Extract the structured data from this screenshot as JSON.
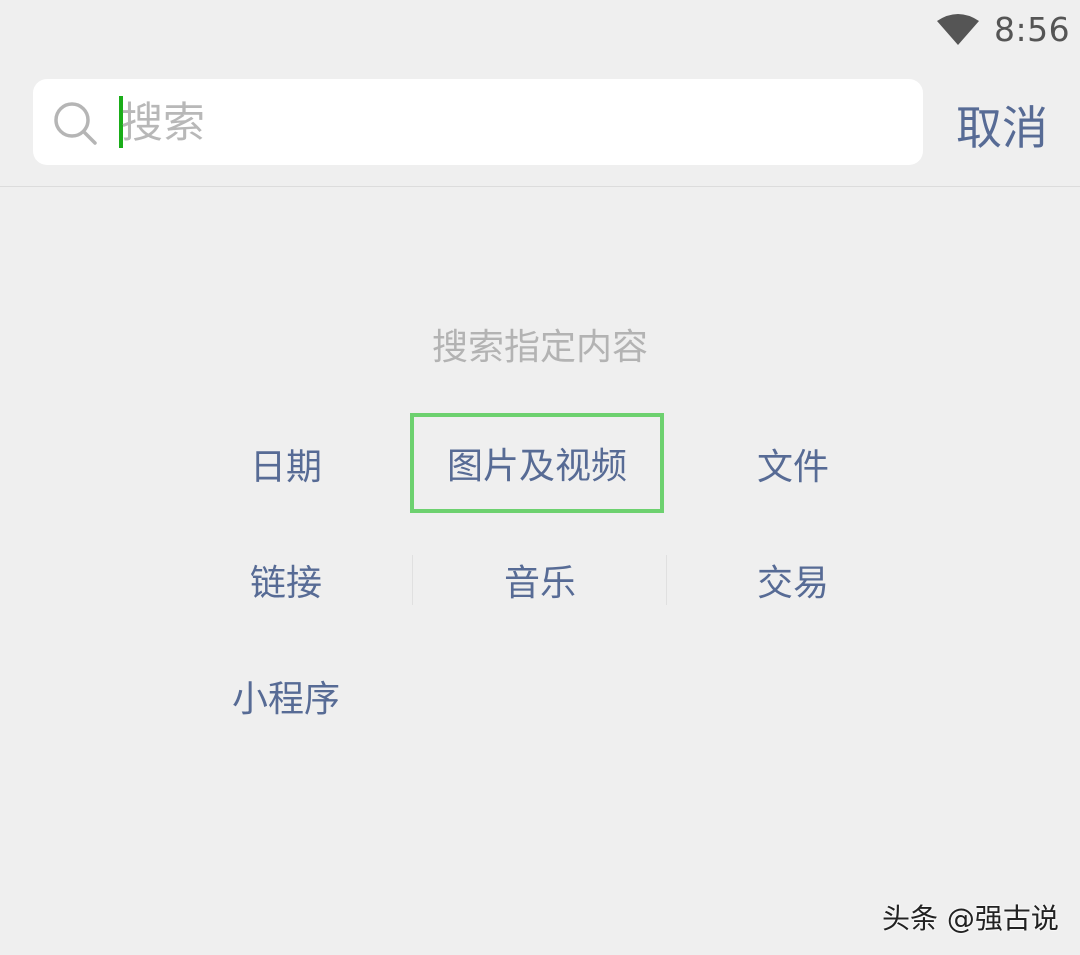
{
  "status_bar": {
    "time": "8:56",
    "wifi_icon": "wifi-icon"
  },
  "search": {
    "placeholder": "搜索",
    "value": "",
    "icon": "search-icon",
    "cancel_label": "取消"
  },
  "content": {
    "title": "搜索指定内容",
    "categories": [
      {
        "label": "日期"
      },
      {
        "label": "图片及视频",
        "highlighted": true
      },
      {
        "label": "文件"
      },
      {
        "label": "链接"
      },
      {
        "label": "音乐"
      },
      {
        "label": "交易"
      },
      {
        "label": "小程序"
      }
    ]
  },
  "watermark": "头条 @强古说",
  "colors": {
    "accent": "#576b95",
    "cursor": "#1aad19",
    "highlight_border": "#6dd16f",
    "background": "#efefef"
  }
}
